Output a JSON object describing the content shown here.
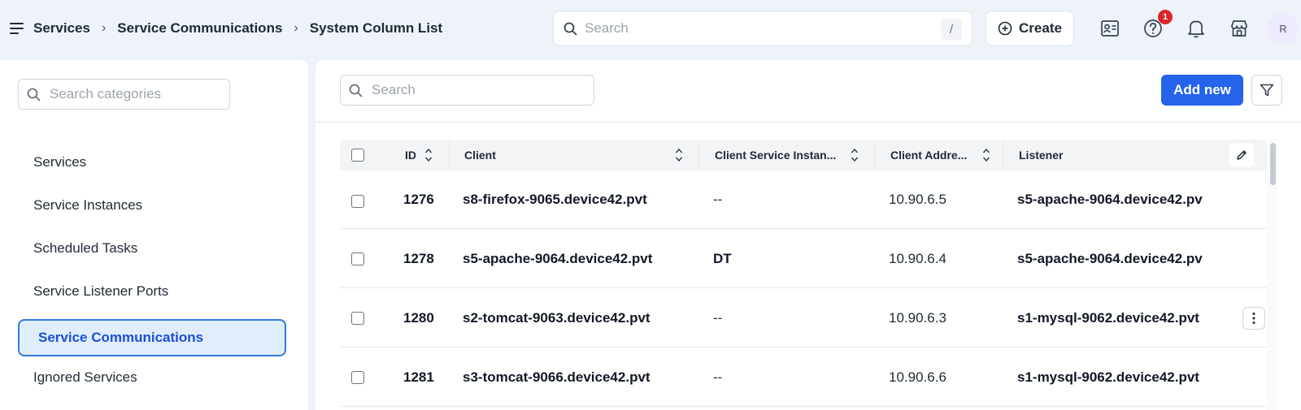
{
  "breadcrumb": [
    "Services",
    "Service Communications",
    "System Column List"
  ],
  "topbar": {
    "search_placeholder": "Search",
    "search_shortcut": "/",
    "create_label": "Create",
    "help_badge": "1",
    "avatar_initial": "R"
  },
  "sidebar": {
    "search_placeholder": "Search categories",
    "items": [
      {
        "label": "Services",
        "active": false
      },
      {
        "label": "Service Instances",
        "active": false
      },
      {
        "label": "Scheduled Tasks",
        "active": false
      },
      {
        "label": "Service Listener Ports",
        "active": false
      },
      {
        "label": "Service Communications",
        "active": true
      },
      {
        "label": "Ignored Services",
        "active": false
      }
    ]
  },
  "main": {
    "search_placeholder": "Search",
    "add_new_label": "Add new"
  },
  "table": {
    "columns": [
      "ID",
      "Client",
      "Client Service Instan...",
      "Client Addre...",
      "Listener"
    ],
    "rows": [
      {
        "id": "1276",
        "client": "s8-firefox-9065.device42.pvt",
        "client_service_instance": "--",
        "client_address": "10.90.6.5",
        "listener": "s5-apache-9064.device42.pv"
      },
      {
        "id": "1278",
        "client": "s5-apache-9064.device42.pvt",
        "client_service_instance": "DT",
        "client_address": "10.90.6.4",
        "listener": "s5-apache-9064.device42.pv"
      },
      {
        "id": "1280",
        "client": "s2-tomcat-9063.device42.pvt",
        "client_service_instance": "--",
        "client_address": "10.90.6.3",
        "listener": "s1-mysql-9062.device42.pvt"
      },
      {
        "id": "1281",
        "client": "s3-tomcat-9066.device42.pvt",
        "client_service_instance": "--",
        "client_address": "10.90.6.6",
        "listener": "s1-mysql-9062.device42.pvt"
      }
    ]
  },
  "colors": {
    "accent": "#2563eb",
    "active_bg": "#e0eefc",
    "badge": "#dc2626",
    "page_bg": "#eef3fa"
  }
}
